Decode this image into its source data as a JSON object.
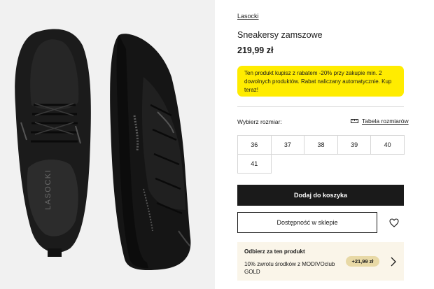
{
  "product": {
    "brand": "Lasocki",
    "title": "Sneakersy zamszowe",
    "price": "219,99 zł",
    "image_logo": "LASOCKI"
  },
  "promo": {
    "text": "Ten produkt kupisz z rabatem -20% przy zakupie min. 2 dowolnych produktów. Rabat naliczany automatycznie. Kup teraz!",
    "background": "#ffec00"
  },
  "sizes": {
    "label": "Wybierz rozmiar:",
    "chart_link": "Tabela rozmiarów",
    "chart_icon": "ruler-icon",
    "options": [
      "36",
      "37",
      "38",
      "39",
      "40",
      "41"
    ]
  },
  "actions": {
    "add_to_cart": "Dodaj do koszyka",
    "store_availability": "Dostępność w sklepie",
    "wishlist_icon": "heart-icon"
  },
  "reward": {
    "title": "Odbierz za ten produkt",
    "text": "10% zwrotu środków z MODIVOclub GOLD",
    "amount": "+21,99 zł",
    "arrow_icon": "chevron-right-icon",
    "background": "#faf5e9"
  }
}
